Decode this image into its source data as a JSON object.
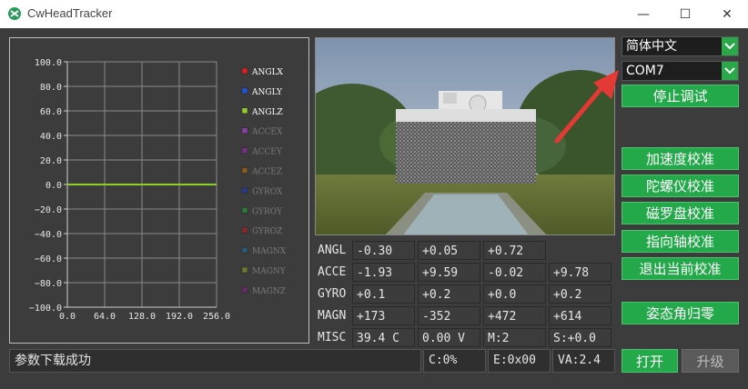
{
  "window": {
    "title": "CwHeadTracker",
    "minimize": "—",
    "maximize": "☐",
    "close": "✕"
  },
  "chart_data": {
    "type": "line",
    "x_ticks": [
      "0.0",
      "64.0",
      "128.0",
      "192.0",
      "256.0"
    ],
    "y_ticks": [
      "100.0",
      "80.0",
      "60.0",
      "40.0",
      "20.0",
      "0.0",
      "−20.0",
      "−40.0",
      "−60.0",
      "−80.0",
      "−100.0"
    ],
    "xlim": [
      0,
      256
    ],
    "ylim": [
      -100,
      100
    ],
    "grid": true,
    "legend_position": "right",
    "series": [
      {
        "name": "ANGLX",
        "color": "#e02020",
        "active": true,
        "values": [
          0,
          0
        ]
      },
      {
        "name": "ANGLY",
        "color": "#2255dd",
        "active": true,
        "values": [
          0,
          0
        ]
      },
      {
        "name": "ANGLZ",
        "color": "#8fcf2a",
        "active": true,
        "values": [
          0,
          0
        ]
      },
      {
        "name": "ACCEX",
        "color": "#8a3fa8",
        "active": false
      },
      {
        "name": "ACCEY",
        "color": "#7a2f8a",
        "active": false
      },
      {
        "name": "ACCEZ",
        "color": "#8a5a20",
        "active": false
      },
      {
        "name": "GYROX",
        "color": "#2a3a8a",
        "active": false
      },
      {
        "name": "GYROY",
        "color": "#2a7a3a",
        "active": false
      },
      {
        "name": "GYROZ",
        "color": "#8a2a2a",
        "active": false
      },
      {
        "name": "MAGNX",
        "color": "#2a5a7a",
        "active": false
      },
      {
        "name": "MAGNY",
        "color": "#6a7a2a",
        "active": false
      },
      {
        "name": "MAGNZ",
        "color": "#6a2a6a",
        "active": false
      }
    ],
    "x": [
      0,
      256
    ]
  },
  "readings": {
    "angl": {
      "label": "ANGL",
      "v1": "-0.30",
      "v2": "+0.05",
      "v3": "+0.72",
      "v4": ""
    },
    "acce": {
      "label": "ACCE",
      "v1": "-1.93",
      "v2": "+9.59",
      "v3": "-0.02",
      "v4": "+9.78"
    },
    "gyro": {
      "label": "GYRO",
      "v1": "+0.1",
      "v2": "+0.2",
      "v3": "+0.0",
      "v4": "+0.2"
    },
    "magn": {
      "label": "MAGN",
      "v1": "+173",
      "v2": "-352",
      "v3": "+472",
      "v4": "+614"
    },
    "misc": {
      "label": "MISC",
      "v1": "39.4 C",
      "v2": "0.00 V",
      "v3": "M:2",
      "v4": "S:+0.0"
    }
  },
  "controls": {
    "language": "简体中文",
    "port": "COM7",
    "stop_debug": "停止调试",
    "accel_cal": "加速度校准",
    "gyro_cal": "陀螺仪校准",
    "mag_cal": "磁罗盘校准",
    "heading_cal": "指向轴校准",
    "exit_cal": "退出当前校准",
    "reset_attitude": "姿态角归零",
    "open": "打开",
    "upgrade": "升级"
  },
  "status": {
    "message": "参数下载成功",
    "c": "C:0%",
    "e": "E:0x00",
    "va": "VA:2.4"
  },
  "colors": {
    "accent_green": "#23a84a",
    "arrow_red": "#e53935"
  }
}
